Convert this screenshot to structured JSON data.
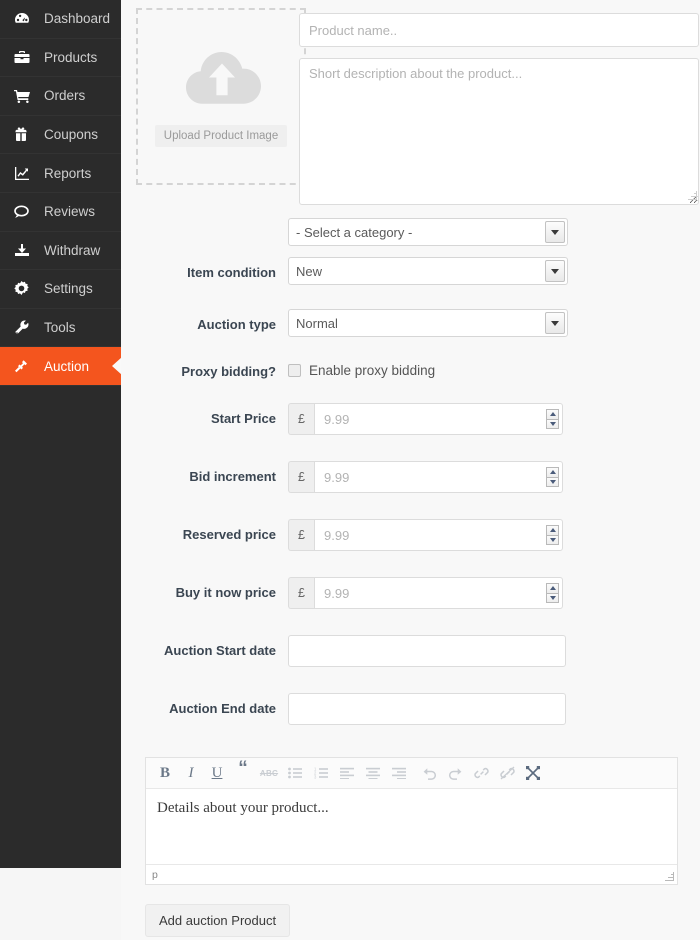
{
  "theme": {
    "sidebar_bg": "#2b2b2b",
    "sidebar_text": "#cfcfcf",
    "active_bg": "#f4551e",
    "page_bg": "#f8f8f8",
    "label_color": "#3b4652",
    "placeholder_color": "#b3b3b3"
  },
  "sidebar": {
    "items": [
      {
        "label": "Dashboard",
        "icon": "dashboard-gauge-icon",
        "active": false
      },
      {
        "label": "Products",
        "icon": "briefcase-icon",
        "active": false
      },
      {
        "label": "Orders",
        "icon": "shopping-cart-icon",
        "active": false
      },
      {
        "label": "Coupons",
        "icon": "gift-icon",
        "active": false
      },
      {
        "label": "Reports",
        "icon": "chart-line-icon",
        "active": false
      },
      {
        "label": "Reviews",
        "icon": "comment-icon",
        "active": false
      },
      {
        "label": "Withdraw",
        "icon": "upload-tray-icon",
        "active": false
      },
      {
        "label": "Settings",
        "icon": "gear-icon",
        "active": false
      },
      {
        "label": "Tools",
        "icon": "wrench-icon",
        "active": false
      },
      {
        "label": "Auction",
        "icon": "gavel-icon",
        "active": true
      }
    ]
  },
  "upload": {
    "icon": "cloud-upload-icon",
    "button_label": "Upload Product Image"
  },
  "form": {
    "product_name": {
      "value": "",
      "placeholder": "Product name.."
    },
    "short_description": {
      "value": "",
      "placeholder": "Short description about the product..."
    },
    "category": {
      "label": "",
      "selected": "- Select a category -",
      "options": [
        "- Select a category -"
      ]
    },
    "item_condition": {
      "label": "Item condition",
      "selected": "New",
      "options": [
        "New"
      ]
    },
    "auction_type": {
      "label": "Auction type",
      "selected": "Normal",
      "options": [
        "Normal"
      ]
    },
    "proxy_bidding": {
      "label": "Proxy bidding?",
      "checkbox_label": "Enable proxy bidding",
      "checked": false
    },
    "start_price": {
      "label": "Start Price",
      "currency": "£",
      "value": "",
      "placeholder": "9.99"
    },
    "bid_increment": {
      "label": "Bid increment",
      "currency": "£",
      "value": "",
      "placeholder": "9.99"
    },
    "reserved_price": {
      "label": "Reserved price",
      "currency": "£",
      "value": "",
      "placeholder": "9.99"
    },
    "buy_it_now_price": {
      "label": "Buy it now price",
      "currency": "£",
      "value": "",
      "placeholder": "9.99"
    },
    "auction_start_date": {
      "label": "Auction Start date",
      "value": "",
      "placeholder": ""
    },
    "auction_end_date": {
      "label": "Auction End date",
      "value": "",
      "placeholder": ""
    }
  },
  "editor": {
    "toolbar": [
      {
        "name": "bold-icon",
        "glyph": "B",
        "disabled": false
      },
      {
        "name": "italic-icon",
        "glyph": "I",
        "disabled": false
      },
      {
        "name": "underline-icon",
        "glyph": "U",
        "disabled": false
      },
      {
        "name": "blockquote-icon",
        "glyph": "“",
        "disabled": false
      },
      {
        "name": "strikethrough-icon",
        "glyph": "ABC",
        "disabled": false
      },
      {
        "name": "unordered-list-icon",
        "glyph": "",
        "disabled": true
      },
      {
        "name": "ordered-list-icon",
        "glyph": "",
        "disabled": true
      },
      {
        "name": "align-left-icon",
        "glyph": "",
        "disabled": true
      },
      {
        "name": "align-center-icon",
        "glyph": "",
        "disabled": true
      },
      {
        "name": "align-right-icon",
        "glyph": "",
        "disabled": true
      },
      {
        "name": "undo-icon",
        "glyph": "",
        "disabled": true
      },
      {
        "name": "redo-icon",
        "glyph": "",
        "disabled": true
      },
      {
        "name": "link-icon",
        "glyph": "",
        "disabled": true
      },
      {
        "name": "unlink-icon",
        "glyph": "",
        "disabled": true
      },
      {
        "name": "fullscreen-icon",
        "glyph": "",
        "disabled": false
      }
    ],
    "content": "Details about your product...",
    "status_path": "p"
  },
  "submit": {
    "label": "Add auction Product"
  }
}
